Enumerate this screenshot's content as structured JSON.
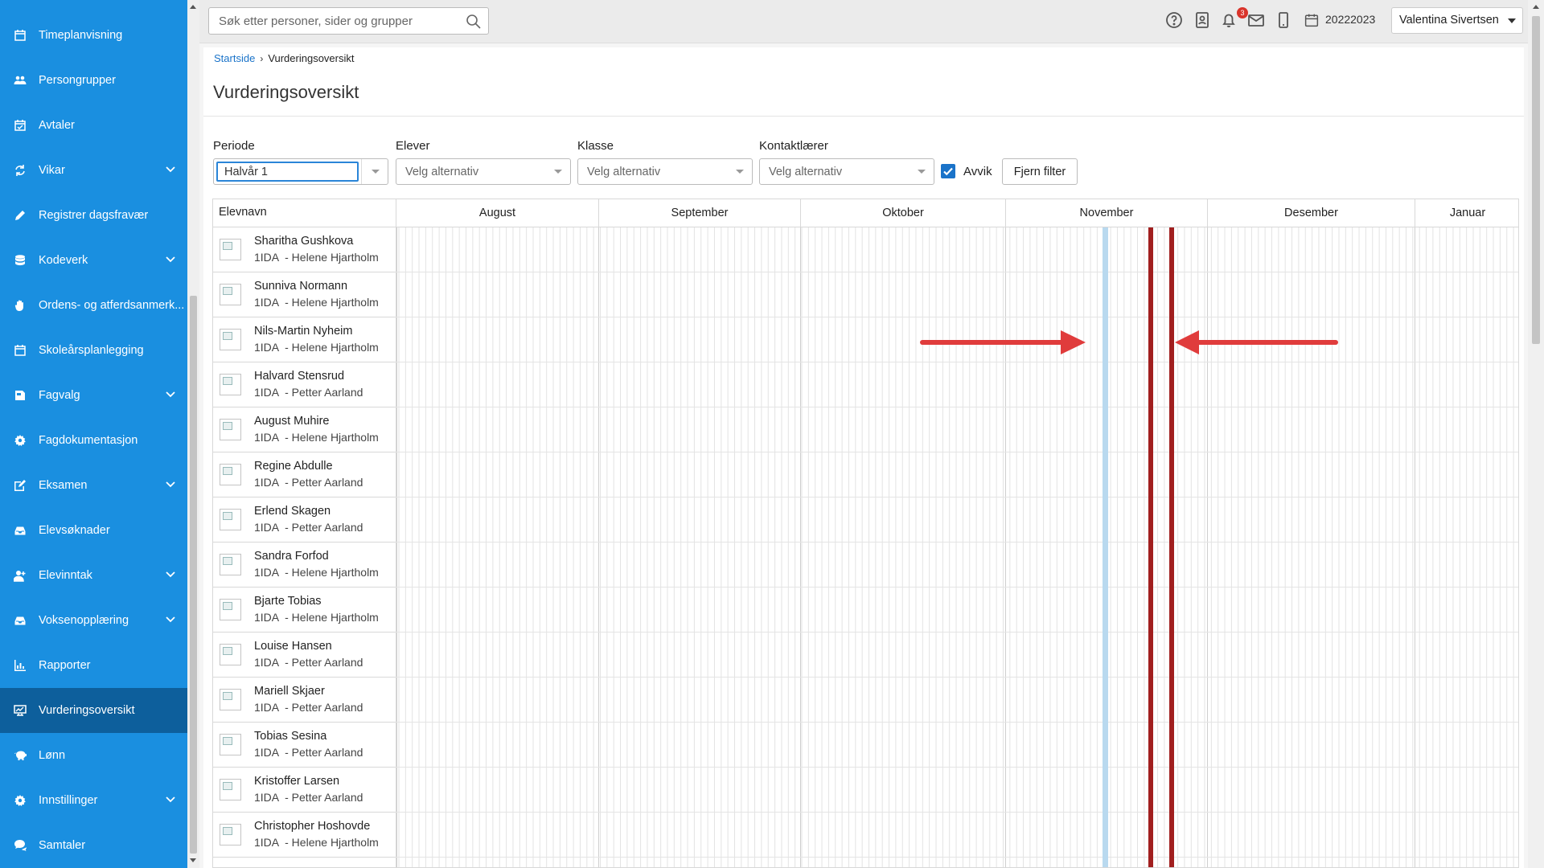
{
  "sidebar": {
    "items": [
      {
        "label": "Timeplanvisning",
        "icon": "calendar-icon",
        "chevron": false,
        "active": false
      },
      {
        "label": "Persongrupper",
        "icon": "users-icon",
        "chevron": false,
        "active": false
      },
      {
        "label": "Avtaler",
        "icon": "calendar-check-icon",
        "chevron": false,
        "active": false
      },
      {
        "label": "Vikar",
        "icon": "sync-icon",
        "chevron": true,
        "active": false
      },
      {
        "label": "Registrer dagsfravær",
        "icon": "pencil-icon",
        "chevron": false,
        "active": false
      },
      {
        "label": "Kodeverk",
        "icon": "database-icon",
        "chevron": true,
        "active": false
      },
      {
        "label": "Ordens- og atferdsanmerk...",
        "icon": "hand-icon",
        "chevron": false,
        "active": false
      },
      {
        "label": "Skoleårsplanlegging",
        "icon": "calendar-icon",
        "chevron": false,
        "active": false
      },
      {
        "label": "Fagvalg",
        "icon": "book-icon",
        "chevron": true,
        "active": false
      },
      {
        "label": "Fagdokumentasjon",
        "icon": "gear-icon",
        "chevron": false,
        "active": false
      },
      {
        "label": "Eksamen",
        "icon": "edit-icon",
        "chevron": true,
        "active": false
      },
      {
        "label": "Elevsøknader",
        "icon": "inbox-icon",
        "chevron": false,
        "active": false
      },
      {
        "label": "Elevinntak",
        "icon": "user-plus-icon",
        "chevron": true,
        "active": false
      },
      {
        "label": "Voksenopplæring",
        "icon": "inbox-icon",
        "chevron": true,
        "active": false
      },
      {
        "label": "Rapporter",
        "icon": "chart-icon",
        "chevron": false,
        "active": false
      },
      {
        "label": "Vurderingsoversikt",
        "icon": "chart-line-icon",
        "chevron": false,
        "active": true
      },
      {
        "label": "Lønn",
        "icon": "piggy-bank-icon",
        "chevron": false,
        "active": false
      },
      {
        "label": "Innstillinger",
        "icon": "gear-icon",
        "chevron": true,
        "active": false
      },
      {
        "label": "Samtaler",
        "icon": "chat-icon",
        "chevron": false,
        "active": false
      }
    ]
  },
  "topbar": {
    "search_placeholder": "Søk etter personer, sider og grupper",
    "notification_count": "3",
    "school_year": "20222023",
    "user_name": "Valentina Sivertsen",
    "icons": [
      "help-icon",
      "contact-card-icon",
      "bell-icon",
      "mail-icon",
      "mobile-icon",
      "calendar-icon"
    ]
  },
  "breadcrumb": {
    "home": "Startside",
    "current": "Vurderingsoversikt"
  },
  "page": {
    "title": "Vurderingsoversikt"
  },
  "filters": {
    "periode": {
      "label": "Periode",
      "value": "Halvår 1"
    },
    "elever": {
      "label": "Elever",
      "placeholder": "Velg alternativ"
    },
    "klasse": {
      "label": "Klasse",
      "placeholder": "Velg alternativ"
    },
    "kontaktlaerer": {
      "label": "Kontaktlærer",
      "placeholder": "Velg alternativ"
    },
    "avvik": {
      "label": "Avvik",
      "checked": true
    },
    "clear_button": "Fjern filter"
  },
  "grid": {
    "name_header": "Elevnavn",
    "months": [
      "August",
      "September",
      "Oktober",
      "November",
      "Desember",
      "Januar"
    ],
    "students": [
      {
        "name": "Sharitha Gushkova",
        "class": "1IDA  - Helene Hjartholm"
      },
      {
        "name": "Sunniva Normann",
        "class": "1IDA  - Helene Hjartholm"
      },
      {
        "name": "Nils-Martin Nyheim",
        "class": "1IDA  - Helene Hjartholm"
      },
      {
        "name": "Halvard Stensrud",
        "class": "1IDA  - Petter Aarland"
      },
      {
        "name": "August Muhire",
        "class": "1IDA  - Helene Hjartholm"
      },
      {
        "name": "Regine Abdulle",
        "class": "1IDA  - Petter Aarland"
      },
      {
        "name": "Erlend Skagen",
        "class": "1IDA  - Petter Aarland"
      },
      {
        "name": "Sandra Forfod",
        "class": "1IDA  - Helene Hjartholm"
      },
      {
        "name": "Bjarte Tobias",
        "class": "1IDA  - Helene Hjartholm"
      },
      {
        "name": "Louise Hansen",
        "class": "1IDA  - Petter Aarland"
      },
      {
        "name": "Mariell Skjaer",
        "class": "1IDA  - Petter Aarland"
      },
      {
        "name": "Tobias Sesina",
        "class": "1IDA  - Petter Aarland"
      },
      {
        "name": "Kristoffer Larsen",
        "class": "1IDA  - Petter Aarland"
      },
      {
        "name": "Christopher Hoshovde",
        "class": "1IDA  - Helene Hjartholm"
      }
    ],
    "colors": {
      "today_marker": "#b9d9ef",
      "deadline_marker": "#a11f1f",
      "annotation_arrow": "#e03c3c"
    }
  }
}
